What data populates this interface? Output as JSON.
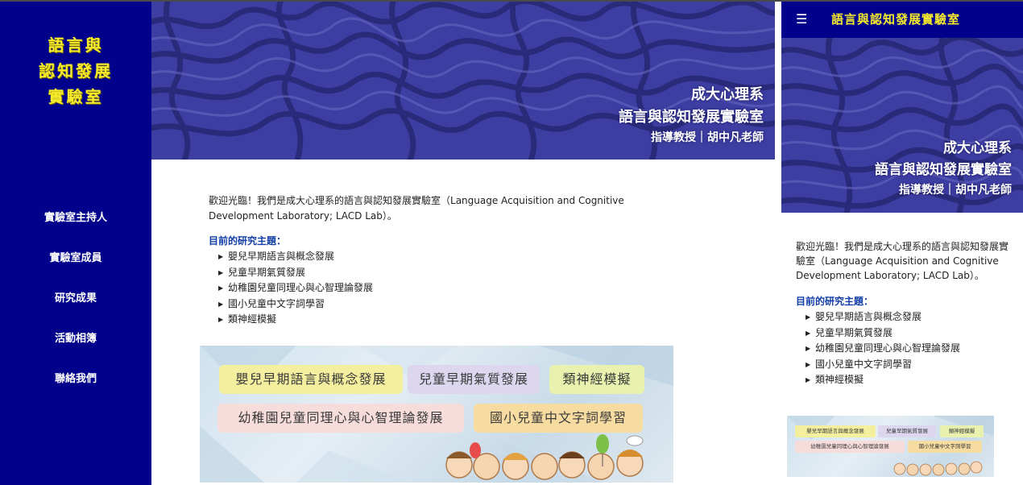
{
  "logo": {
    "lines": [
      "語言與",
      "認知發展",
      "實驗室"
    ]
  },
  "nav": {
    "items": [
      {
        "label": "實驗室主持人"
      },
      {
        "label": "實驗室成員"
      },
      {
        "label": "研究成果"
      },
      {
        "label": "活動相簿"
      },
      {
        "label": "聯絡我們"
      }
    ]
  },
  "hero": {
    "dept": "成大心理系",
    "lab": "語言與認知發展實驗室",
    "advisor": "指導教授｜胡中凡老師"
  },
  "intro": {
    "text": "歡迎光臨！我們是成大心理系的語言與認知發展實驗室（Language Acquisition and Cognitive Development Laboratory; LACD Lab）。"
  },
  "research": {
    "heading": "目前的研究主題：",
    "bullet": "▶",
    "topics": [
      "嬰兒早期語言與概念發展",
      "兒童早期氣質發展",
      "幼稚園兒童同理心與心智理論發展",
      "國小兒童中文字詞學習",
      "類神經模擬"
    ]
  },
  "banner": {
    "tags": [
      "嬰兒早期語言與概念發展",
      "兒童早期氣質發展",
      "類神經模擬",
      "幼稚園兒童同理心與心智理論發展",
      "國小兒童中文字詞學習"
    ]
  },
  "mobile": {
    "menu_icon": "☰",
    "title": "語言與認知發展實驗室"
  },
  "colors": {
    "sidebar": "#01018c",
    "logo_yellow": "#f6ec2c",
    "heading_blue": "#123ea7",
    "hero_blue": "#3e3e9f"
  }
}
